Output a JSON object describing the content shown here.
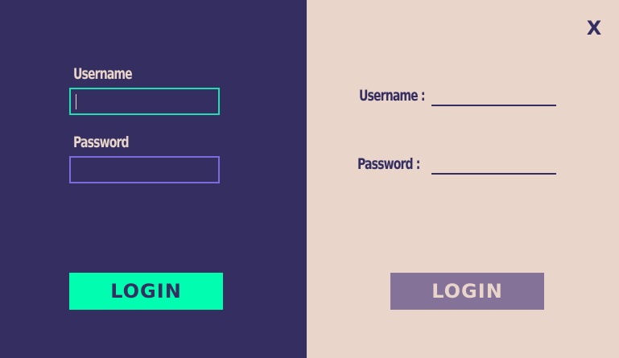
{
  "colors": {
    "left_panel_bg": "#352f61",
    "right_panel_bg": "#e9d5ca",
    "username_field_border": "#1fdfb0",
    "password_field_border": "#7c6bdc",
    "login_primary_bg": "#00fdb0",
    "login_secondary_bg": "#857298",
    "text_dark": "#352f61",
    "text_light": "#e9d5ca"
  },
  "left_form": {
    "username_label": "Username",
    "username_value": "",
    "password_label": "Password",
    "password_value": "",
    "login_label": "LOGIN"
  },
  "right_form": {
    "username_label": "Username :",
    "password_label": "Password :",
    "login_label": "LOGIN"
  },
  "close": {
    "label": "X",
    "icon": "close-icon"
  }
}
